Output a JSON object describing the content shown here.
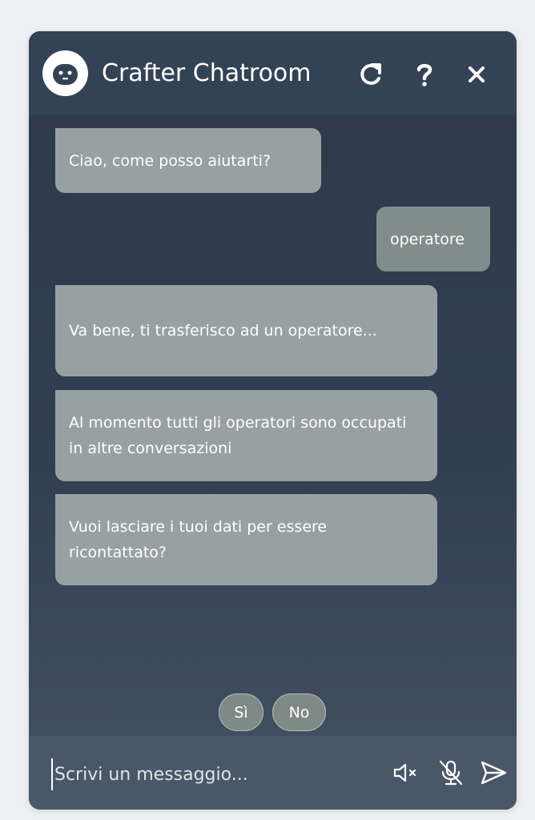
{
  "header": {
    "title": "Crafter Chatroom",
    "icons": [
      "bot-avatar",
      "refresh-icon",
      "help-icon",
      "close-icon"
    ]
  },
  "messages": [
    {
      "from": "bot",
      "text": "Ciao, come posso aiutarti?"
    },
    {
      "from": "user",
      "text": "operatore"
    },
    {
      "from": "bot",
      "text": "Va bene, ti trasferisco ad un operatore..."
    },
    {
      "from": "bot",
      "text": "Al momento tutti gli operatori sono occupati in altre conversazioni"
    },
    {
      "from": "bot",
      "text": "Vuoi lasciare i tuoi dati per essere ricontattato?"
    }
  ],
  "quick_replies": [
    "Sì",
    "No"
  ],
  "composer": {
    "placeholder": "Scrivi un messaggio...",
    "value": "",
    "icons": [
      "speaker-muted-icon",
      "microphone-off-icon",
      "send-icon"
    ]
  },
  "colors": {
    "header": "#344256",
    "background": "#2e394b",
    "bubble": "#98a1a1",
    "quick_reply": "#7f8a87",
    "text": "#ffffff"
  }
}
